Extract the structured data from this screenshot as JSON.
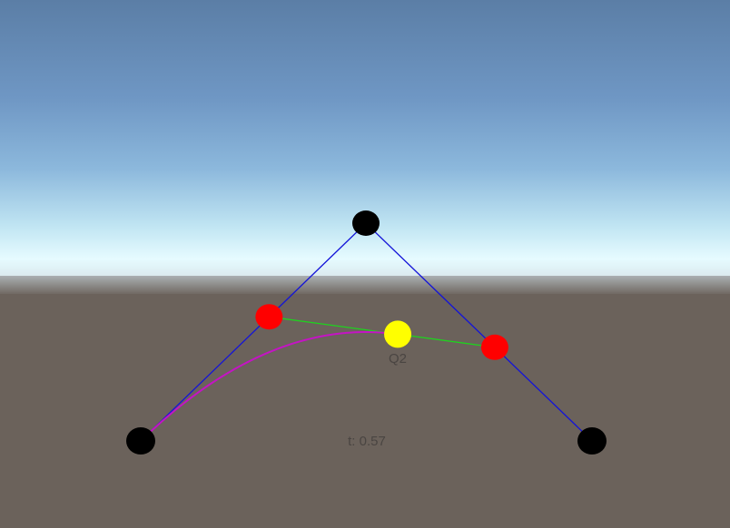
{
  "scene": {
    "point_label": "Q2",
    "t_readout": "t: 0.57",
    "t_value": 0.57
  },
  "colors": {
    "sky_top": "#5a7fa6",
    "sky_mid": "#7fa7cf",
    "horizon": "#e8fbff",
    "ground": "#6b625b",
    "control_polygon": "#1414d8",
    "control_point": "#000000",
    "interpolated_point": "#ff0000",
    "inner_segment": "#1fd21f",
    "bezier_point": "#ffff00",
    "bezier_curve": "#c414c4"
  },
  "icons": {
    "control_point": "black-circle",
    "interpolated_point": "red-circle",
    "bezier_point": "yellow-circle"
  }
}
